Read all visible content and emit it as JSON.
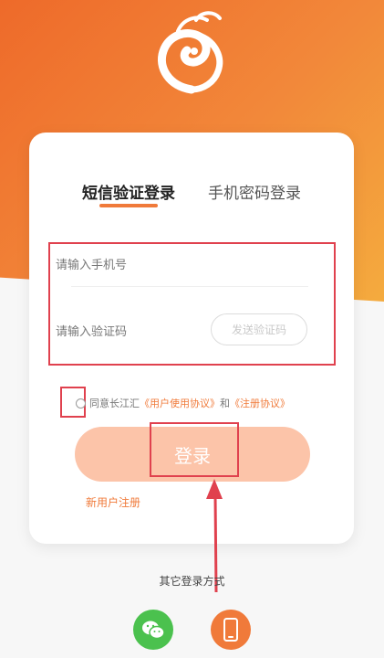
{
  "brand": {
    "logo": "dragon-logo"
  },
  "tabs": [
    {
      "label": "短信验证登录",
      "active": true
    },
    {
      "label": "手机密码登录",
      "active": false
    }
  ],
  "form": {
    "phone_placeholder": "请输入手机号",
    "code_placeholder": "请输入验证码",
    "send_code_label": "发送验证码"
  },
  "agreement": {
    "prefix": "同意长江汇",
    "user_agreement": "《用户使用协议》",
    "and": "和",
    "register_agreement": "《注册协议》"
  },
  "login_button": "登录",
  "register_link": "新用户注册",
  "other_login": {
    "label": "其它登录方式",
    "options": [
      "wechat-icon",
      "phone-icon"
    ]
  },
  "colors": {
    "accent": "#f07a3a",
    "highlight": "#e0414e",
    "login_button_bg": "#fcc4a9",
    "wechat": "#4bc14e"
  }
}
